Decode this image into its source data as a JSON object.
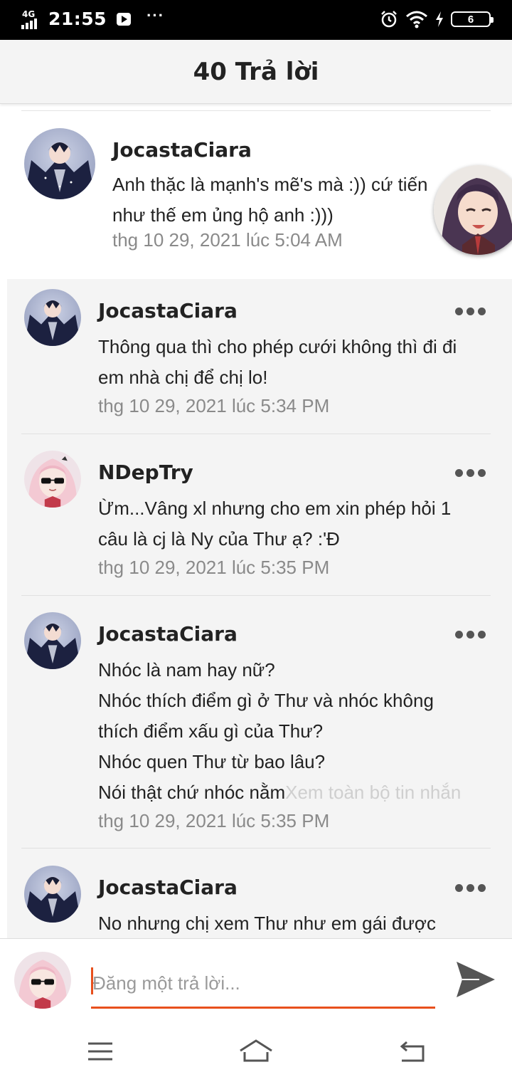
{
  "status_bar": {
    "network": "4G",
    "time": "21:55",
    "more": "···",
    "battery": "6"
  },
  "header": {
    "title": "40 Trả lời"
  },
  "parent_comment": {
    "author": "JocastaCiara",
    "text_lines": [
      "Anh thặc là mạnh's mẽ's mà :)) cứ tiến",
      "như thế em ủng hộ anh :)))"
    ],
    "time": "thg 10 29, 2021 lúc 5:04 AM"
  },
  "replies": [
    {
      "author": "JocastaCiara",
      "lines": [
        "Thông qua thì cho phép cưới không thì đi đi",
        "em nhà chị để chị lo!"
      ],
      "time": "thg 10 29, 2021 lúc 5:34 PM"
    },
    {
      "author": "NDepTry",
      "lines": [
        "Ừm...Vâng xl nhưng cho em xin phép hỏi 1",
        "câu là cj là Ny của Thư ạ? :'Đ"
      ],
      "time": "thg 10 29, 2021 lúc 5:35 PM"
    },
    {
      "author": "JocastaCiara",
      "lines": [
        "Nhóc là nam hay nữ?",
        "Nhóc thích điểm gì ở Thư và nhóc không",
        "thích điểm xấu gì của Thư?",
        "Nhóc quen Thư từ bao lâu?"
      ],
      "truncated_line": "Nói thật chứ nhóc nằm",
      "see_all": "Xem toàn bộ tin nhắn",
      "time": "thg 10 29, 2021 lúc 5:35 PM"
    },
    {
      "author": "JocastaCiara",
      "lines": [
        "No nhưng chị xem Thư như em gái được"
      ]
    }
  ],
  "compose": {
    "placeholder": "Đăng một trả lời..."
  },
  "icons": {
    "send": "send-icon",
    "more": "more-options-icon",
    "nav_menu": "menu-icon",
    "nav_home": "home-icon",
    "nav_back": "back-icon"
  },
  "colors": {
    "accent": "#e8501d",
    "timestamp": "#8a8a8a",
    "reply_bg": "#f4f4f4"
  }
}
